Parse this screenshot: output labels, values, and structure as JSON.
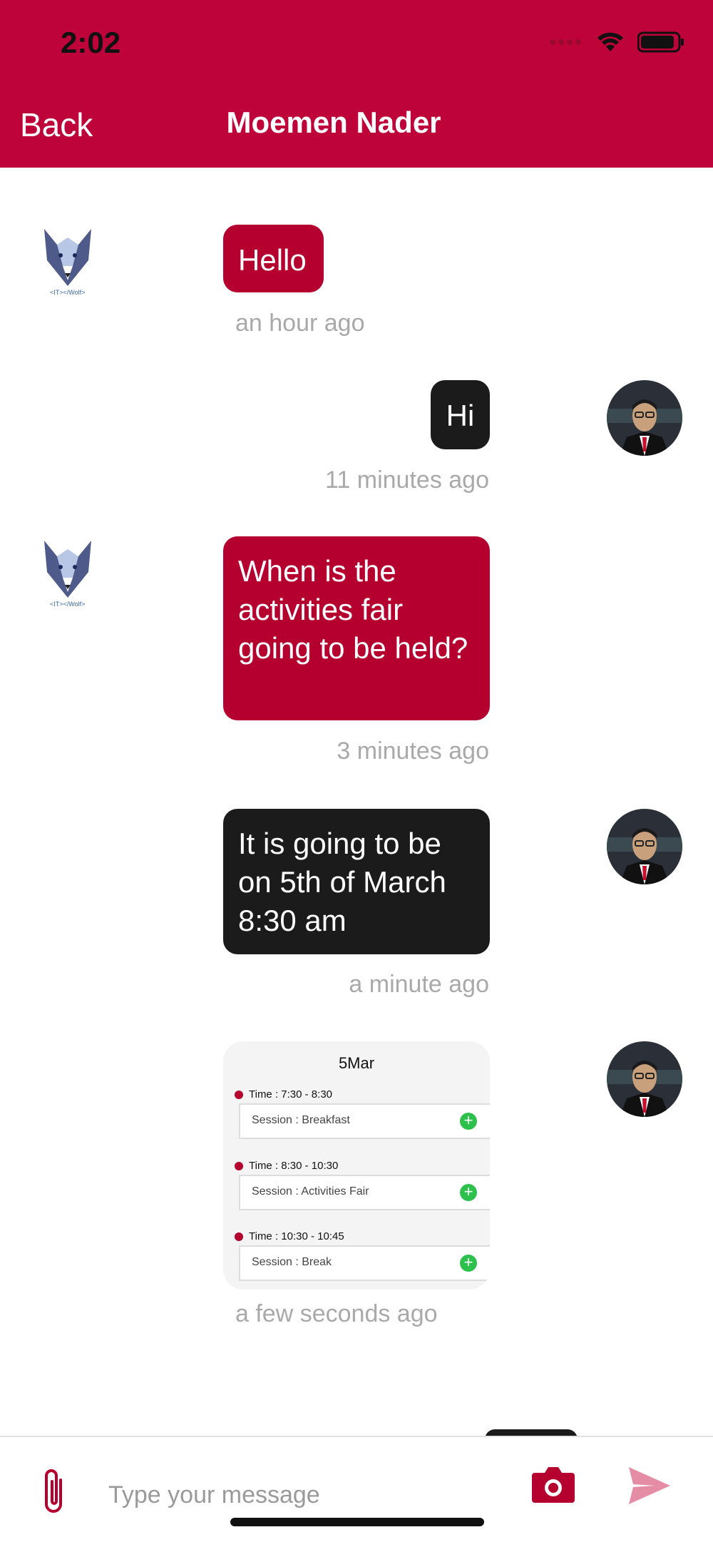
{
  "status_bar": {
    "time": "2:02"
  },
  "header": {
    "back_label": "Back",
    "title": "Moemen Nader"
  },
  "messages": [
    {
      "sender": "other",
      "text": "Hello",
      "timestamp": "an hour ago"
    },
    {
      "sender": "me",
      "text": "Hi",
      "timestamp": "11 minutes ago"
    },
    {
      "sender": "other",
      "text": "When is the activities fair going to be held?",
      "timestamp": "3 minutes ago"
    },
    {
      "sender": "me",
      "text": "It is going to be on 5th of March 8:30 am",
      "timestamp": "a minute ago"
    },
    {
      "sender": "me",
      "type": "schedule",
      "timestamp": "a few seconds ago"
    }
  ],
  "schedule_card": {
    "date": "5Mar",
    "slots": [
      {
        "time": "Time : 7:30 - 8:30",
        "session": "Session : Breakfast"
      },
      {
        "time": "Time : 8:30 - 10:30",
        "session": "Session : Activities Fair"
      },
      {
        "time": "Time : 10:30 - 10:45",
        "session": "Session : Break"
      }
    ]
  },
  "avatar_logo_text": "<IT></Wolf>",
  "composer": {
    "placeholder": "Type your message"
  },
  "colors": {
    "brand": "#bd0339",
    "bubble_other": "#b5002f",
    "bubble_me": "#1b1b1b",
    "timestamp": "#a9a9a9",
    "add_green": "#2ec04d"
  }
}
